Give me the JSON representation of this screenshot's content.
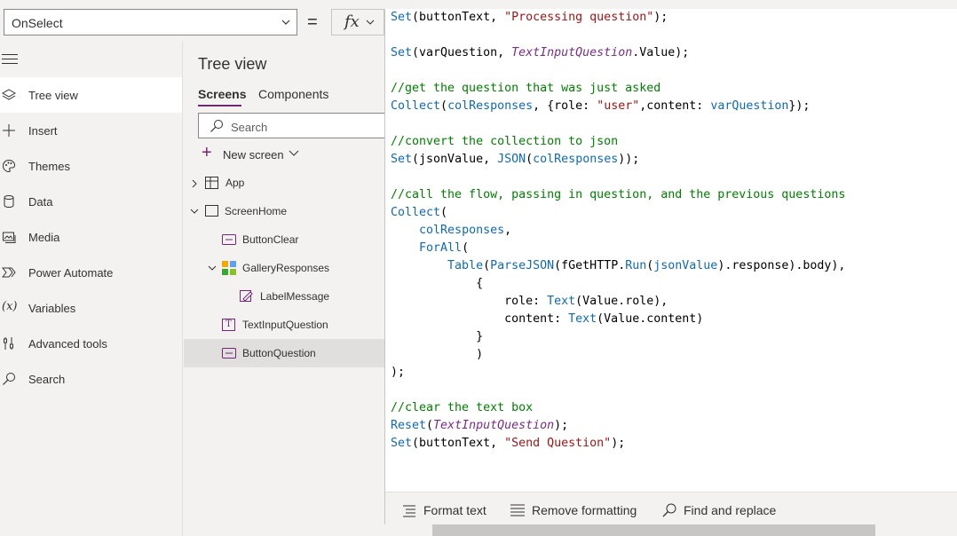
{
  "formula_bar": {
    "property": "OnSelect",
    "equals": "=",
    "fx": "fx"
  },
  "left_nav": {
    "items": [
      {
        "label": "Tree view",
        "icon": "layers-icon"
      },
      {
        "label": "Insert",
        "icon": "plus-icon"
      },
      {
        "label": "Themes",
        "icon": "palette-icon"
      },
      {
        "label": "Data",
        "icon": "database-icon"
      },
      {
        "label": "Media",
        "icon": "media-icon"
      },
      {
        "label": "Power Automate",
        "icon": "power-automate-icon"
      },
      {
        "label": "Variables",
        "icon": "variables-icon"
      },
      {
        "label": "Advanced tools",
        "icon": "tools-icon"
      },
      {
        "label": "Search",
        "icon": "search-icon"
      }
    ],
    "variables_glyph": "(x)"
  },
  "tree": {
    "title": "Tree view",
    "tabs": [
      "Screens",
      "Components"
    ],
    "search_placeholder": "Search",
    "new_screen": "New screen",
    "nodes": [
      {
        "label": "App",
        "icon": "app-icon"
      },
      {
        "label": "ScreenHome",
        "icon": "screen-icon"
      },
      {
        "label": "ButtonClear",
        "icon": "button-icon"
      },
      {
        "label": "GalleryResponses",
        "icon": "gallery-icon"
      },
      {
        "label": "LabelMessage",
        "icon": "label-icon"
      },
      {
        "label": "TextInputQuestion",
        "icon": "text-input-icon"
      },
      {
        "label": "ButtonQuestion",
        "icon": "button-icon"
      }
    ],
    "text_input_glyph": "T"
  },
  "code": [
    [
      [
        "fn",
        "Set"
      ],
      [
        "p",
        "(buttonText, "
      ],
      [
        "s",
        "\"Processing question\""
      ],
      [
        "p",
        ");"
      ]
    ],
    [],
    [
      [
        "fn",
        "Set"
      ],
      [
        "p",
        "(varQuestion, "
      ],
      [
        "c",
        "TextInputQuestion"
      ],
      [
        "p",
        ".Value);"
      ]
    ],
    [],
    [
      [
        "cm",
        "//get the question that was just asked"
      ]
    ],
    [
      [
        "fn",
        "Collect"
      ],
      [
        "p",
        "("
      ],
      [
        "v",
        "colResponses"
      ],
      [
        "p",
        ", {role: "
      ],
      [
        "s",
        "\"user\""
      ],
      [
        "p",
        ",content: "
      ],
      [
        "v",
        "varQuestion"
      ],
      [
        "p",
        "});"
      ]
    ],
    [],
    [
      [
        "cm",
        "//convert the collection to json"
      ]
    ],
    [
      [
        "fn",
        "Set"
      ],
      [
        "p",
        "(jsonValue, "
      ],
      [
        "fn",
        "JSON"
      ],
      [
        "p",
        "("
      ],
      [
        "v",
        "colResponses"
      ],
      [
        "p",
        "));"
      ]
    ],
    [],
    [
      [
        "cm",
        "//call the flow, passing in question, and the previous questions"
      ]
    ],
    [
      [
        "fn",
        "Collect"
      ],
      [
        "p",
        "("
      ]
    ],
    [
      [
        "p",
        "    "
      ],
      [
        "v",
        "colResponses"
      ],
      [
        "p",
        ","
      ]
    ],
    [
      [
        "p",
        "    "
      ],
      [
        "fn",
        "ForAll"
      ],
      [
        "p",
        "("
      ]
    ],
    [
      [
        "p",
        "        "
      ],
      [
        "fn",
        "Table"
      ],
      [
        "p",
        "("
      ],
      [
        "fn",
        "ParseJSON"
      ],
      [
        "p",
        "(fGetHTTP."
      ],
      [
        "fn",
        "Run"
      ],
      [
        "p",
        "("
      ],
      [
        "v",
        "jsonValue"
      ],
      [
        "p",
        ").response).body),"
      ]
    ],
    [
      [
        "p",
        "            {"
      ]
    ],
    [
      [
        "p",
        "                role: "
      ],
      [
        "fn",
        "Text"
      ],
      [
        "p",
        "(Value.role),"
      ]
    ],
    [
      [
        "p",
        "                content: "
      ],
      [
        "fn",
        "Text"
      ],
      [
        "p",
        "(Value.content)"
      ]
    ],
    [
      [
        "p",
        "            }"
      ]
    ],
    [
      [
        "p",
        "            )"
      ]
    ],
    [
      [
        "p",
        ");"
      ]
    ],
    [],
    [
      [
        "cm",
        "//clear the text box"
      ]
    ],
    [
      [
        "fn",
        "Reset"
      ],
      [
        "p",
        "("
      ],
      [
        "c",
        "TextInputQuestion"
      ],
      [
        "p",
        ");"
      ]
    ],
    [
      [
        "fn",
        "Set"
      ],
      [
        "p",
        "(buttonText, "
      ],
      [
        "s",
        "\"Send Question\""
      ],
      [
        "p",
        ");"
      ]
    ]
  ],
  "footer": {
    "format_text": "Format text",
    "remove_formatting": "Remove formatting",
    "find_replace": "Find and replace"
  },
  "colors": {
    "accent": "#742774",
    "function": "#0e6ab8",
    "string": "#a31515",
    "comment": "#008000",
    "control": "#7a2c8c"
  }
}
